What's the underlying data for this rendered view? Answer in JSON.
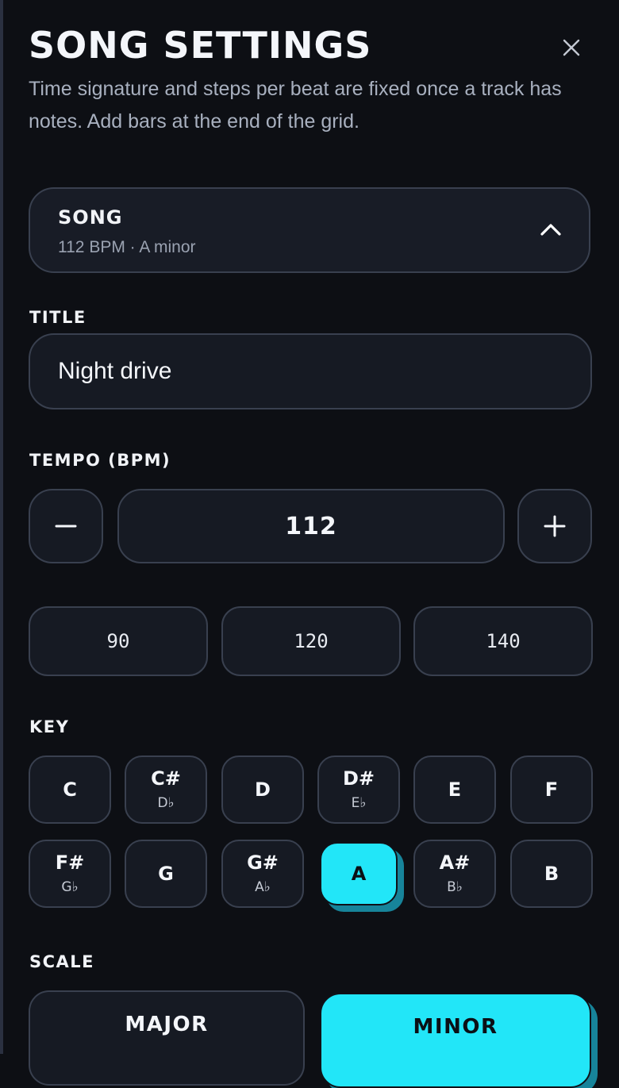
{
  "header": {
    "title": "SONG SETTINGS",
    "subtitle": "Time signature and steps per beat are fixed once a track has notes. Add bars at the end of the grid.",
    "close_icon": "close-icon"
  },
  "song_card": {
    "title": "SONG",
    "summary": "112 BPM · A minor",
    "toggle_icon": "chevron-up-icon"
  },
  "title_field": {
    "label": "TITLE",
    "value": "Night drive"
  },
  "tempo": {
    "label": "TEMPO (BPM)",
    "value": "112",
    "decrement_icon": "minus-icon",
    "increment_icon": "plus-icon",
    "presets": [
      "90",
      "120",
      "140"
    ]
  },
  "key": {
    "label": "KEY",
    "selected": "A",
    "keys": [
      {
        "name": "C",
        "flat": ""
      },
      {
        "name": "C#",
        "flat": "D♭"
      },
      {
        "name": "D",
        "flat": ""
      },
      {
        "name": "D#",
        "flat": "E♭"
      },
      {
        "name": "E",
        "flat": ""
      },
      {
        "name": "F",
        "flat": ""
      },
      {
        "name": "F#",
        "flat": "G♭"
      },
      {
        "name": "G",
        "flat": ""
      },
      {
        "name": "G#",
        "flat": "A♭"
      },
      {
        "name": "A",
        "flat": ""
      },
      {
        "name": "A#",
        "flat": "B♭"
      },
      {
        "name": "B",
        "flat": ""
      }
    ]
  },
  "scale": {
    "label": "SCALE",
    "options": [
      "MAJOR",
      "MINOR"
    ],
    "selected": "MINOR"
  },
  "colors": {
    "background": "#0d0f14",
    "surface": "#161a23",
    "border": "#39404f",
    "accent": "#22e6f8",
    "accent_shadow": "#17849a"
  }
}
